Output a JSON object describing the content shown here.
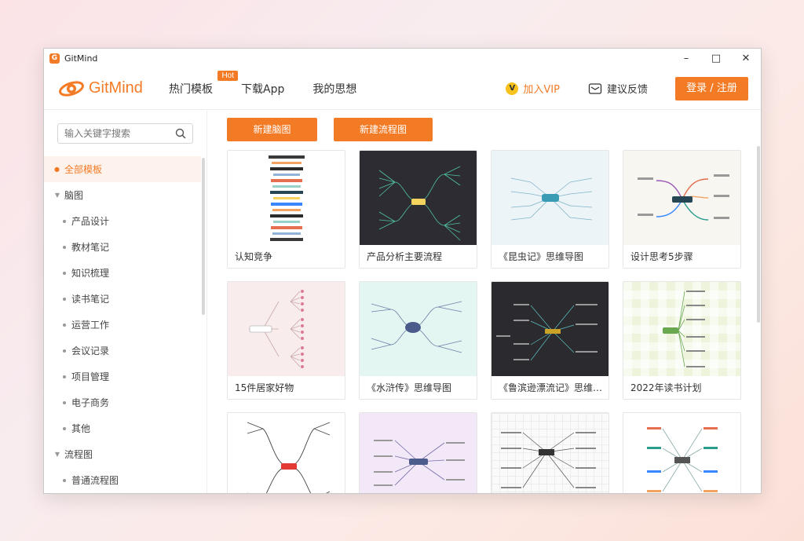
{
  "window": {
    "title": "GitMind"
  },
  "header": {
    "brand": "GitMind",
    "nav": [
      {
        "label": "热门模板",
        "badge": "Hot"
      },
      {
        "label": "下载App"
      },
      {
        "label": "我的思想"
      }
    ],
    "vip_label": "加入VIP",
    "feedback_label": "建议反馈",
    "login_label": "登录 / 注册"
  },
  "sidebar": {
    "search_placeholder": "输入关键字搜索",
    "items": [
      {
        "label": "全部模板",
        "level": 0,
        "active": true
      },
      {
        "label": "脑图",
        "level": 0
      },
      {
        "label": "产品设计",
        "level": 1
      },
      {
        "label": "教材笔记",
        "level": 1
      },
      {
        "label": "知识梳理",
        "level": 1
      },
      {
        "label": "读书笔记",
        "level": 1
      },
      {
        "label": "运营工作",
        "level": 1
      },
      {
        "label": "会议记录",
        "level": 1
      },
      {
        "label": "项目管理",
        "level": 1
      },
      {
        "label": "电子商务",
        "level": 1
      },
      {
        "label": "其他",
        "level": 1
      },
      {
        "label": "流程图",
        "level": 0
      },
      {
        "label": "普通流程图",
        "level": 1
      }
    ]
  },
  "actions": {
    "new_mindmap": "新建脑图",
    "new_flowchart": "新建流程图"
  },
  "templates": [
    {
      "label": "认知竞争"
    },
    {
      "label": "产品分析主要流程"
    },
    {
      "label": "《昆虫记》思维导图"
    },
    {
      "label": "设计思考5步骤"
    },
    {
      "label": "15件居家好物"
    },
    {
      "label": "《水浒传》思维导图"
    },
    {
      "label": "《鲁滨逊漂流记》思维导图"
    },
    {
      "label": "2022年读书计划"
    },
    {
      "label": ""
    },
    {
      "label": ""
    },
    {
      "label": ""
    },
    {
      "label": ""
    }
  ],
  "colors": {
    "accent": "#f47b26",
    "active_bg": "#fdf2ec"
  }
}
